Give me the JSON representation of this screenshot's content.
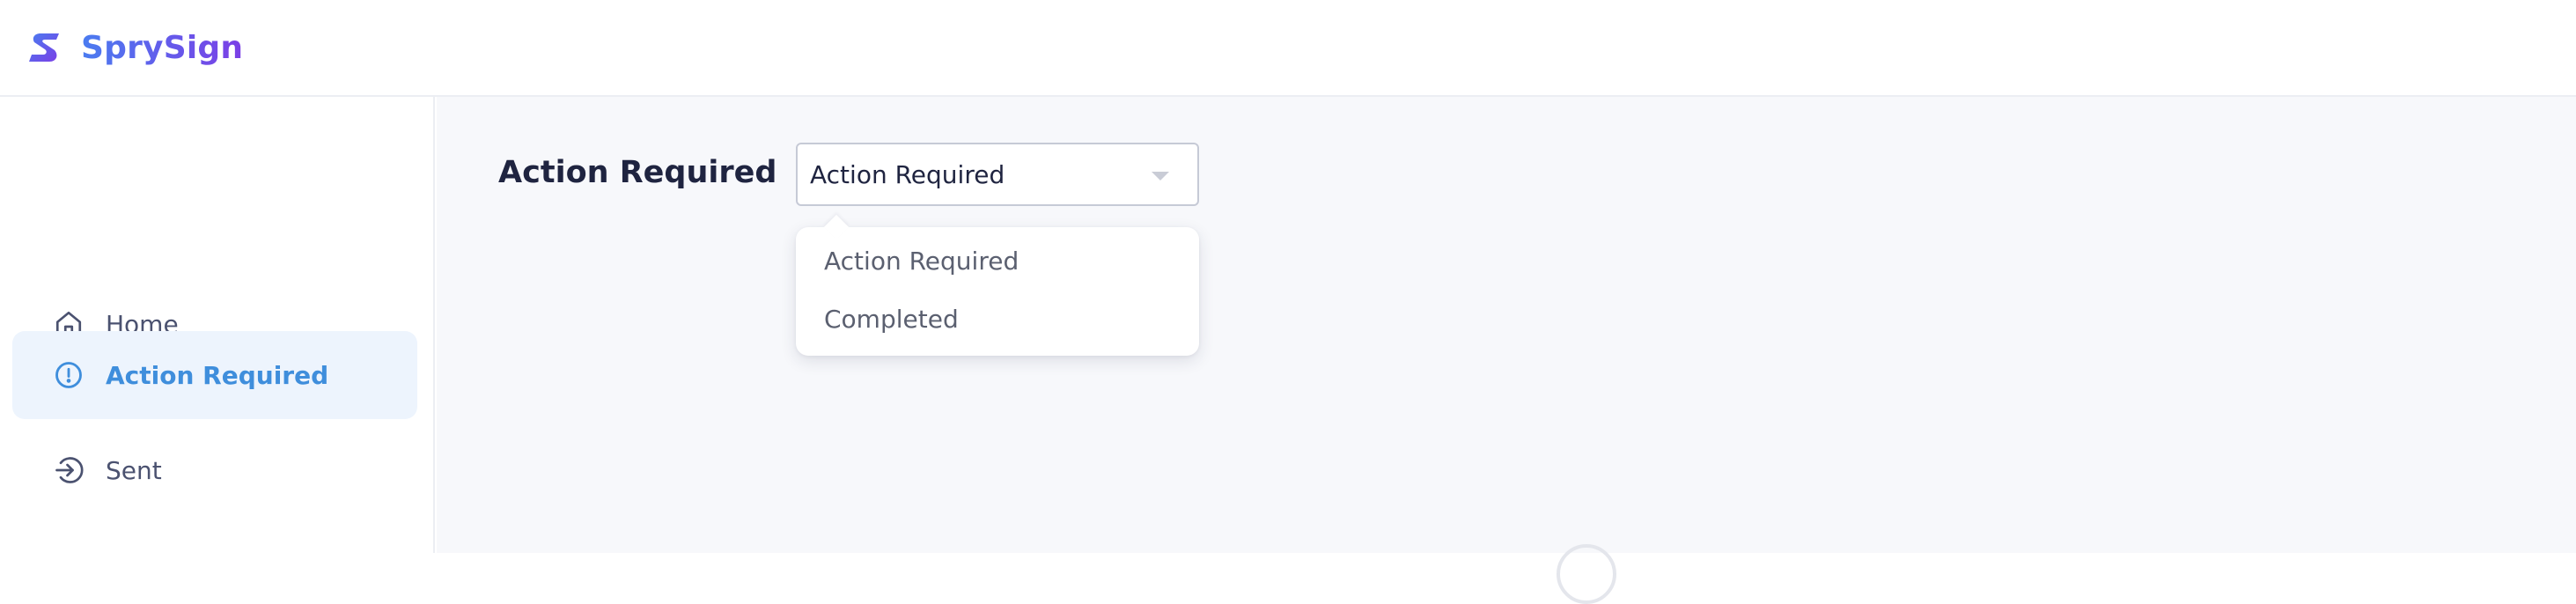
{
  "brand": {
    "name": "SprySign",
    "logo_icon": "sprysign-logo-icon",
    "gradient": [
      "#4a7cf0",
      "#7b3fe6"
    ]
  },
  "sidebar": {
    "items": [
      {
        "label": "Home",
        "icon": "home-icon",
        "active": false
      },
      {
        "label": "Action Required",
        "icon": "alert-circle-icon",
        "active": true
      },
      {
        "label": "Sent",
        "icon": "sent-icon",
        "active": false
      }
    ]
  },
  "main": {
    "title": "Action Required",
    "filter": {
      "selected": "Action Required",
      "options": [
        "Action Required",
        "Completed"
      ]
    }
  },
  "colors": {
    "accent": "#3f8edc",
    "active_bg": "#edf4fd",
    "main_bg": "#f7f8fb",
    "text_dark": "#1f2440"
  }
}
